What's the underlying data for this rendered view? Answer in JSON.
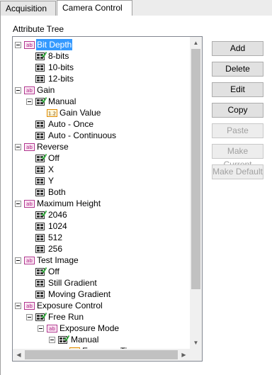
{
  "tabs": [
    {
      "label": "Acquisition"
    },
    {
      "label": "Camera Control"
    }
  ],
  "attribute_tree": {
    "label": "Attribute Tree",
    "nodes": [
      {
        "label": "Bit Depth",
        "icon": "string-attribute-icon",
        "level": 0,
        "toggle": true,
        "selected": true
      },
      {
        "label": "8-bits",
        "icon": "enum-checked-icon",
        "level": 1
      },
      {
        "label": "10-bits",
        "icon": "enum-icon",
        "level": 1
      },
      {
        "label": "12-bits",
        "icon": "enum-icon",
        "level": 1
      },
      {
        "label": "Gain",
        "icon": "string-attribute-icon",
        "level": 0,
        "toggle": true
      },
      {
        "label": "Manual",
        "icon": "enum-checked-icon",
        "level": 1,
        "toggle": true
      },
      {
        "label": "Gain Value",
        "icon": "float-value-icon",
        "level": 2
      },
      {
        "label": "Auto - Once",
        "icon": "enum-icon",
        "level": 1
      },
      {
        "label": "Auto - Continuous",
        "icon": "enum-icon",
        "level": 1
      },
      {
        "label": "Reverse",
        "icon": "string-attribute-icon",
        "level": 0,
        "toggle": true
      },
      {
        "label": "Off",
        "icon": "enum-checked-icon",
        "level": 1
      },
      {
        "label": "X",
        "icon": "enum-icon",
        "level": 1
      },
      {
        "label": "Y",
        "icon": "enum-icon",
        "level": 1
      },
      {
        "label": "Both",
        "icon": "enum-icon",
        "level": 1
      },
      {
        "label": "Maximum Height",
        "icon": "string-attribute-icon",
        "level": 0,
        "toggle": true
      },
      {
        "label": "2046",
        "icon": "enum-checked-icon",
        "level": 1
      },
      {
        "label": "1024",
        "icon": "enum-icon",
        "level": 1
      },
      {
        "label": "512",
        "icon": "enum-icon",
        "level": 1
      },
      {
        "label": "256",
        "icon": "enum-icon",
        "level": 1
      },
      {
        "label": "Test Image",
        "icon": "string-attribute-icon",
        "level": 0,
        "toggle": true
      },
      {
        "label": "Off",
        "icon": "enum-checked-icon",
        "level": 1
      },
      {
        "label": "Still Gradient",
        "icon": "enum-icon",
        "level": 1
      },
      {
        "label": "Moving Gradient",
        "icon": "enum-icon",
        "level": 1
      },
      {
        "label": "Exposure Control",
        "icon": "string-attribute-icon",
        "level": 0,
        "toggle": true
      },
      {
        "label": "Free Run",
        "icon": "enum-checked-icon",
        "level": 1,
        "toggle": true
      },
      {
        "label": "Exposure Mode",
        "icon": "string-attribute-icon",
        "level": 2,
        "toggle": true
      },
      {
        "label": "Manual",
        "icon": "enum-checked-icon",
        "level": 3,
        "toggle": true
      },
      {
        "label": "Exposure Ti",
        "icon": "float-value-icon",
        "level": 4
      }
    ]
  },
  "buttons": {
    "add": "Add",
    "delete": "Delete",
    "edit": "Edit",
    "copy": "Copy",
    "paste": "Paste",
    "make_current": "Make Current",
    "make_default": "Make Default"
  },
  "colors": {
    "selection": "#3399ff",
    "string_icon": "#b0308c",
    "float_icon": "#e08a00",
    "check": "#2fa83a"
  }
}
